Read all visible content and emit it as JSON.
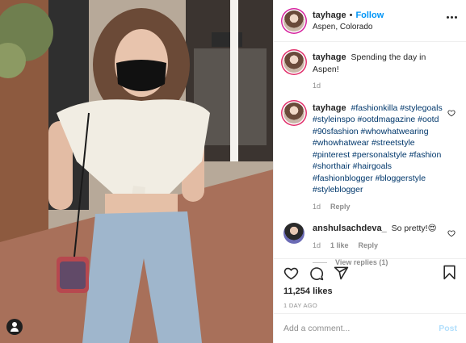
{
  "post": {
    "author": {
      "username": "tayhage",
      "follow_label": "Follow",
      "location": "Aspen, Colorado"
    },
    "more_icon": "more-horizontal-icon",
    "caption": {
      "username": "tayhage",
      "text": "Spending the day in Aspen!",
      "time": "1d"
    },
    "comments": [
      {
        "username": "tayhage",
        "text": "#fashionkilla #stylegoals #styleinspo #ootdmagazine #ootd #90sfashion #whowhatwearing #whowhatwear #streetstyle #pinterest #personalstyle #fashion #shorthair #hairgoals #fashionblogger #bloggerstyle #styleblogger",
        "time": "1d",
        "reply_label": "Reply",
        "like_icon": "heart-icon"
      },
      {
        "username": "anshulsachdeva_",
        "text": "So pretty!😍",
        "time": "1d",
        "likes": "1 like",
        "reply_label": "Reply",
        "like_icon": "heart-icon"
      }
    ],
    "view_replies_label": "View replies (1)",
    "actions": {
      "icons": [
        "heart-icon",
        "comment-icon",
        "share-icon",
        "bookmark-icon"
      ]
    },
    "likes": "11,254 likes",
    "posted_ago": "1 DAY AGO",
    "add_comment": {
      "placeholder": "Add a comment...",
      "post_label": "Post"
    },
    "colors": {
      "link_blue": "#0095f6",
      "hashtag": "#00376b",
      "muted": "#8e8e8e",
      "post_disabled": "#b2dffc"
    }
  }
}
